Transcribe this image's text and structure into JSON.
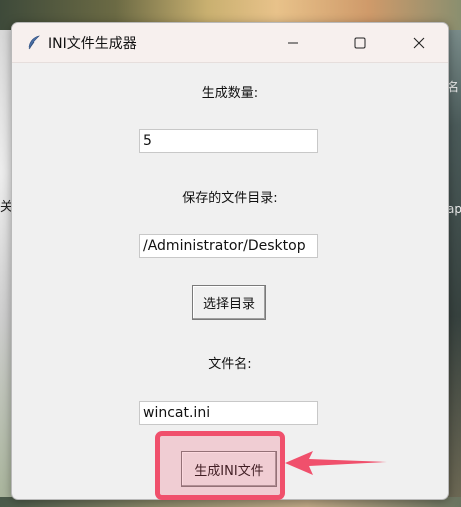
{
  "window": {
    "title": "INI文件生成器"
  },
  "form": {
    "count_label": "生成数量:",
    "count_value": "5",
    "dir_label": "保存的文件目录:",
    "dir_value": "/Administrator/Desktop",
    "choose_dir_button": "选择目录",
    "filename_label": "文件名:",
    "filename_value": "wincat.ini",
    "generate_button": "生成INI文件"
  },
  "background": {
    "left_edge_text": "关",
    "right_edge_text_1": "名",
    "right_edge_text_2": "ap"
  },
  "annotation": {
    "highlight_color": "#f0506c"
  },
  "icons": {
    "app": "feather-icon",
    "minimize": "minimize-icon",
    "maximize": "maximize-icon",
    "close": "close-icon"
  }
}
